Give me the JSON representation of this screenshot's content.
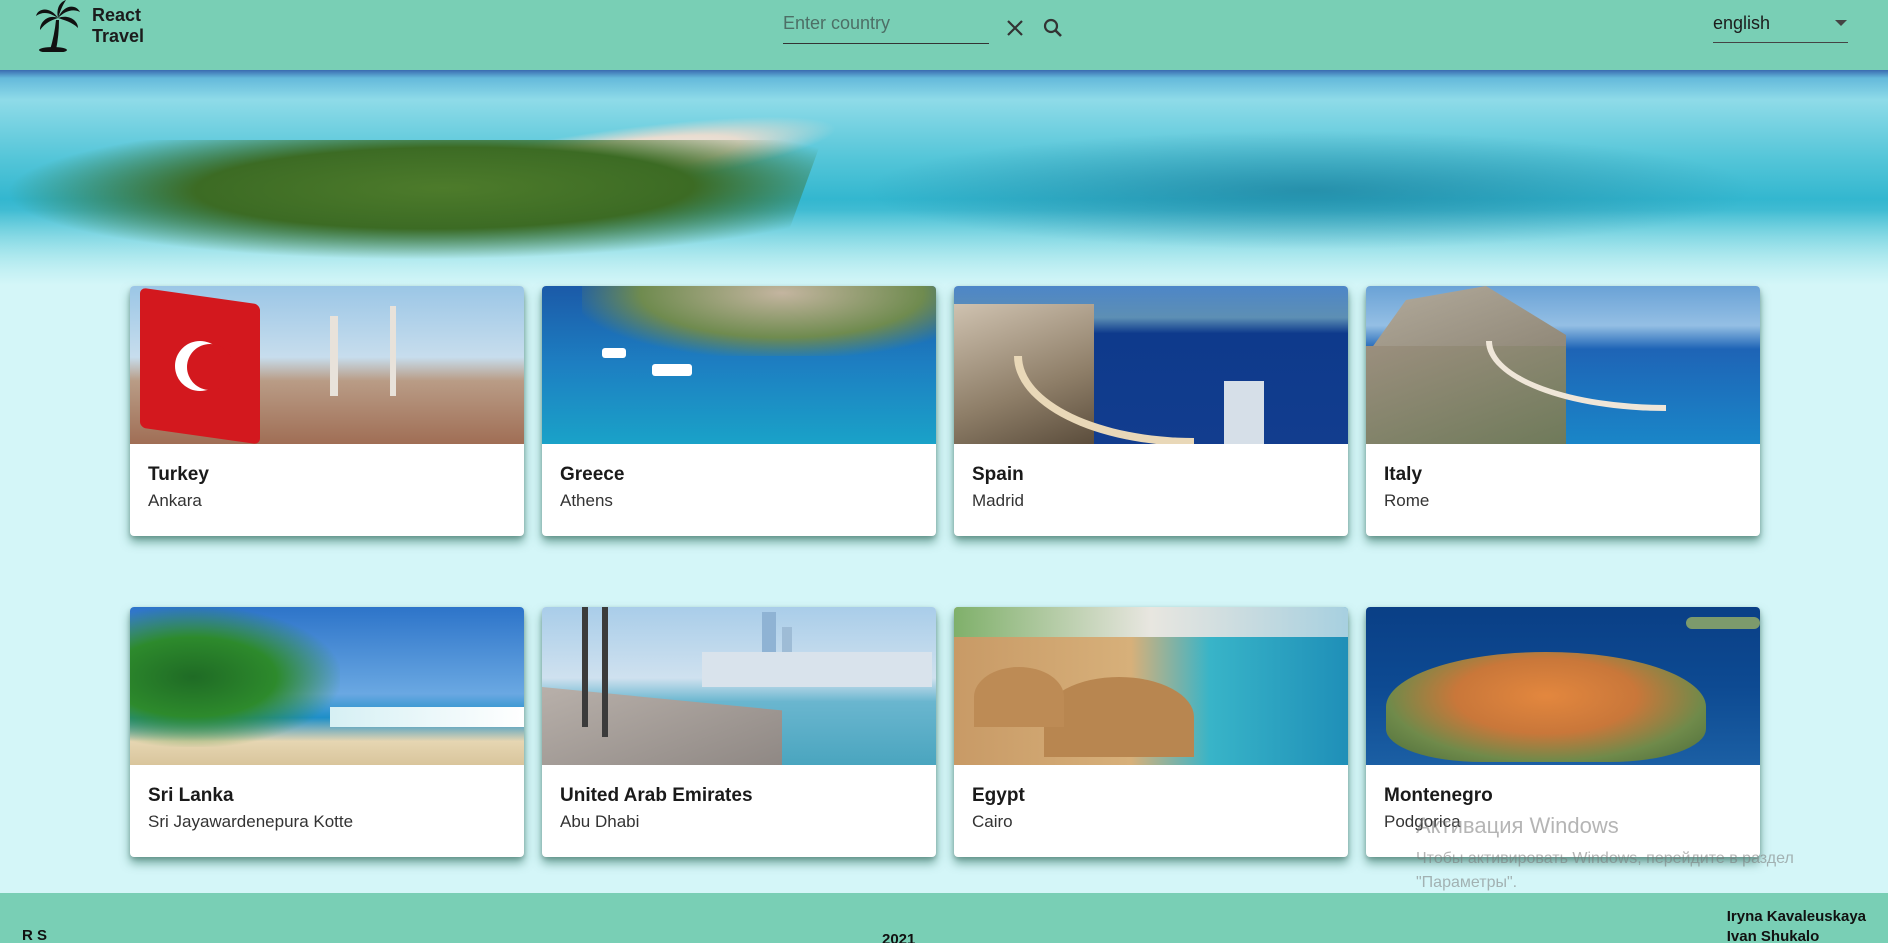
{
  "header": {
    "logo_text": "React Travel",
    "search": {
      "placeholder": "Enter country",
      "value": ""
    },
    "language": {
      "selected": "english"
    }
  },
  "cards": [
    {
      "country": "Turkey",
      "capital": "Ankara"
    },
    {
      "country": "Greece",
      "capital": "Athens"
    },
    {
      "country": "Spain",
      "capital": "Madrid"
    },
    {
      "country": "Italy",
      "capital": "Rome"
    },
    {
      "country": "Sri Lanka",
      "capital": "Sri Jayawardenepura Kotte"
    },
    {
      "country": "United Arab Emirates",
      "capital": "Abu Dhabi"
    },
    {
      "country": "Egypt",
      "capital": "Cairo"
    },
    {
      "country": "Montenegro",
      "capital": "Podgorica"
    }
  ],
  "footer": {
    "rs_logo": "R S",
    "year": "2021",
    "authors": [
      "Iryna Kavaleuskaya",
      "Ivan Shukalo"
    ]
  },
  "os_watermark": {
    "title": "Активация Windows",
    "subtitle": "Чтобы активировать Windows, перейдите в раздел \"Параметры\"."
  },
  "colors": {
    "header_bg": "#79cfb5",
    "page_bg": "#d4f6f8",
    "card_bg": "#ffffff"
  }
}
